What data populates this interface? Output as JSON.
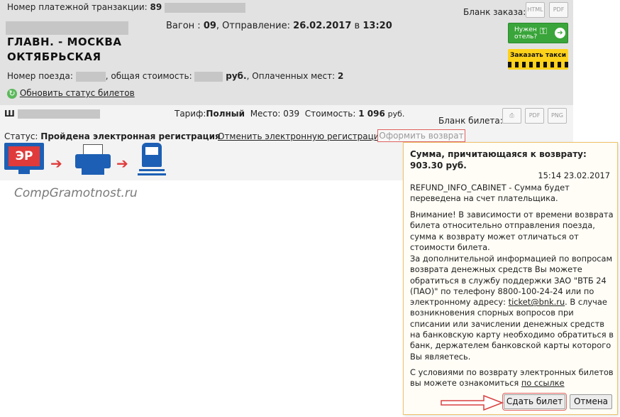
{
  "order": {
    "txn_label": "Номер платежной транзакции:",
    "txn_value": "89",
    "order_form_label": "Бланк заказа:",
    "car_label": "Вагон :",
    "car_value": "09",
    "departure_label": ", Отправление:",
    "departure_date": "26.02.2017",
    "departure_in": "в",
    "departure_time": "13:20",
    "route_line1": "ГЛАВН. - МОСКВА",
    "route_line2": "ОКТЯБРЬСКАЯ",
    "train_label": "Номер поезда:",
    "total_label": ", общая стоимость:",
    "currency": "руб.",
    "paid_label": ", Оплаченных мест:",
    "paid_value": "2",
    "refresh_label": "Обновить статус билетов",
    "hotel_line1": "Нужен",
    "hotel_line2": "отель?",
    "taxi_label": "Заказать такси",
    "icon_html": "HTML",
    "icon_pdf": "PDF"
  },
  "ticket": {
    "passenger_initial": "Ш",
    "tariff_label": "Тариф:",
    "tariff_value": "Полный",
    "seat_label": "Место:",
    "seat_value": "039",
    "cost_label": "Стоимость:",
    "cost_value": "1 096",
    "cost_currency": "руб.",
    "form_label": "Бланк билета:",
    "icon_pdf": "PDF",
    "icon_png": "PNG",
    "status_label": "Статус:",
    "status_value": "Пройдена электронная регистрация",
    "cancel_reg": "Отменить электронную регистрацию",
    "refund_link": "Оформить возврат",
    "er_badge": "ЭР"
  },
  "watermark": "CompGramotnost.ru",
  "popup": {
    "heading": "Сумма, причитающаяся к возврату: 903.30 руб.",
    "date": "15:14 23.02.2017",
    "info": "REFUND_INFO_CABINET - Сумма будет переведена на счет плательщика.",
    "warning": "Внимание! В зависимости от времени возврата билета относительно отправления поезда, сумма к возврату может отличаться от стоимости билета.",
    "support_1": "За дополнительной информацией по вопросам возврата денежных средств Вы можете обратиться в службу поддержки ЗАО \"ВТБ 24 (ПАО)\" по телефону 8800-100-24-24 или по электронному адресу:",
    "support_email": "ticket@bnk.ru",
    "support_2": ". В случае возникновения спорных вопросов при списании или зачислении денежных средств на банковскую карту необходимо обратиться в банк, держателем банковской карты которого Вы являетесь.",
    "terms_text": "С условиями по возврату электронных билетов вы можете ознакомиться",
    "terms_link": "по ссылке",
    "submit_label": "Сдать билет",
    "cancel_label": "Отмена"
  },
  "colors": {
    "header_bg": "#e2e2e2",
    "accent_red": "#e03a3a",
    "hotel_green": "#3aa53a",
    "taxi_yellow": "#ffd21a",
    "popup_border": "#f0c46a"
  }
}
